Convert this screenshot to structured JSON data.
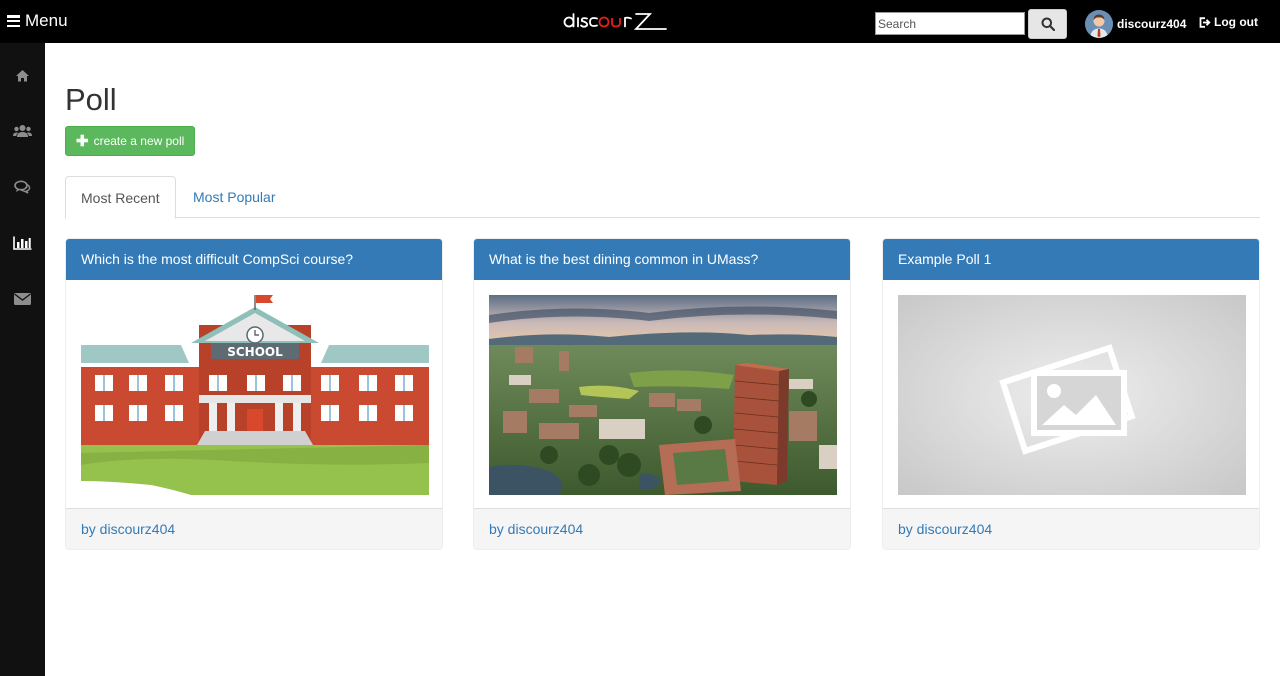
{
  "topbar": {
    "menu_label": "Menu",
    "search_placeholder": "Search",
    "username": "discourz404",
    "logout_label": "Log out"
  },
  "sidebar": {
    "items": [
      {
        "icon": "home-icon"
      },
      {
        "icon": "users-icon"
      },
      {
        "icon": "chat-icon"
      },
      {
        "icon": "bar-chart-icon"
      },
      {
        "icon": "envelope-icon"
      }
    ]
  },
  "page": {
    "title": "Poll",
    "create_button": "create a new poll"
  },
  "tabs": [
    {
      "label": "Most Recent",
      "active": true
    },
    {
      "label": "Most Popular",
      "active": false
    }
  ],
  "polls": [
    {
      "title": "Which is the most difficult CompSci course?",
      "author": "by discourz404",
      "image": "school-illustration"
    },
    {
      "title": "What is the best dining common in UMass?",
      "author": "by discourz404",
      "image": "campus-aerial-photo"
    },
    {
      "title": "Example Poll 1",
      "author": "by discourz404",
      "image": "image-placeholder-icon"
    }
  ],
  "colors": {
    "primary": "#337ab7",
    "success": "#5cb85c",
    "topbar": "#000000",
    "sidebar": "#111111"
  }
}
